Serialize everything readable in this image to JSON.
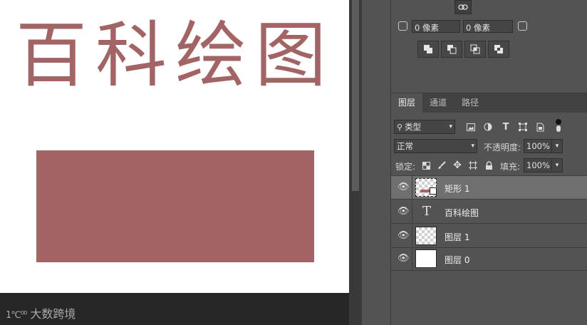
{
  "canvas": {
    "title_text": "百科绘图",
    "text_color": "#a26464",
    "rect_color": "#a26464",
    "watermark": {
      "mark": "1℃⁰⁰",
      "text": "大数跨境"
    }
  },
  "properties": {
    "link_icon": "link-icon",
    "corner_left_value": "0 像素",
    "corner_right_value": "0 像素",
    "path_ops": [
      "combine-shapes-icon",
      "subtract-front-icon",
      "intersect-icon",
      "exclude-overlap-icon"
    ]
  },
  "layers_panel": {
    "tabs": [
      "图层",
      "通道",
      "路径"
    ],
    "filter": {
      "icon": "search-icon",
      "label": "类型",
      "icons": [
        "image-filter-icon",
        "adjustment-filter-icon",
        "type-filter-icon",
        "shape-filter-icon",
        "smart-object-filter-icon",
        "filter-toggle-icon"
      ]
    },
    "blend_mode": "正常",
    "opacity_label": "不透明度:",
    "opacity_value": "100%",
    "lock_label": "锁定:",
    "lock_icons": [
      "lock-transparency-icon",
      "lock-paint-icon",
      "lock-position-icon",
      "lock-artboard-icon",
      "lock-all-icon"
    ],
    "fill_label": "填充:",
    "fill_value": "100%",
    "layers": [
      {
        "name": "矩形 1",
        "kind": "shape",
        "selected": true
      },
      {
        "name": "百科绘图",
        "kind": "text",
        "selected": false
      },
      {
        "name": "图层 1",
        "kind": "transparent",
        "selected": false
      },
      {
        "name": "图层 0",
        "kind": "white",
        "selected": false
      }
    ]
  }
}
